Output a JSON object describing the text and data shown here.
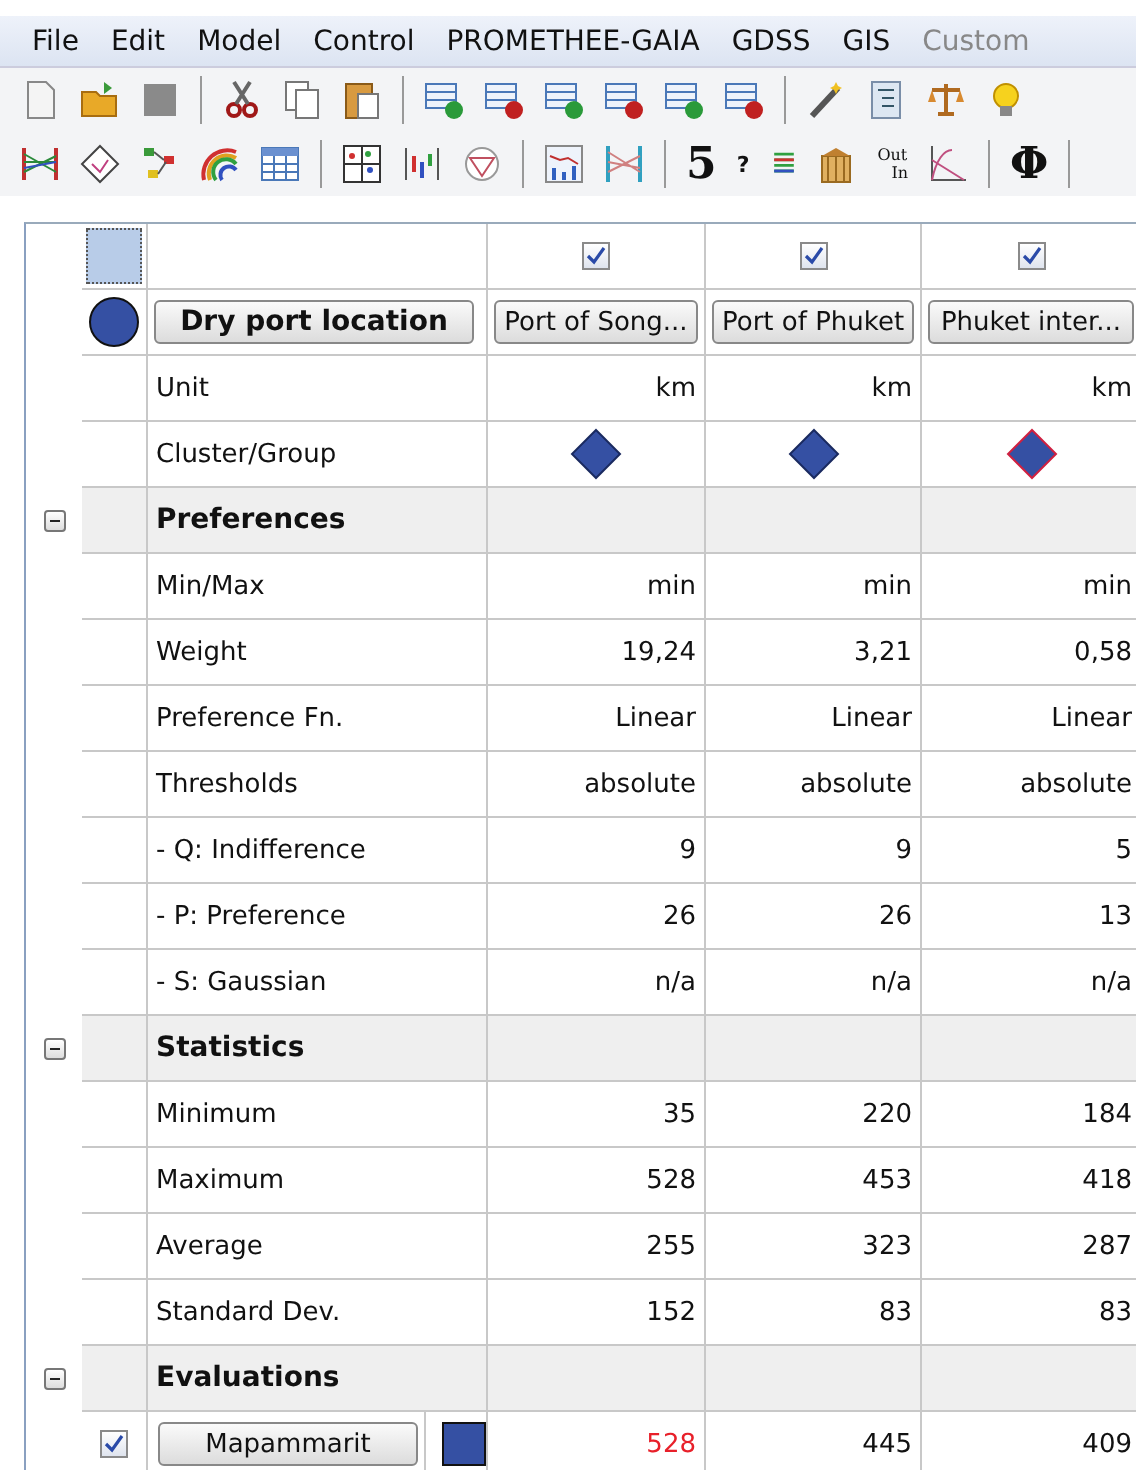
{
  "menu": [
    {
      "label": "File",
      "disabled": false
    },
    {
      "label": "Edit",
      "disabled": false
    },
    {
      "label": "Model",
      "disabled": false
    },
    {
      "label": "Control",
      "disabled": false
    },
    {
      "label": "PROMETHEE-GAIA",
      "disabled": false
    },
    {
      "label": "GDSS",
      "disabled": false
    },
    {
      "label": "GIS",
      "disabled": false
    },
    {
      "label": "Custom",
      "disabled": true
    }
  ],
  "toolbar": {
    "number_glyph": "5",
    "help_glyph": "?",
    "out_label": "Out",
    "in_label": "In",
    "phi_glyph": "Φ"
  },
  "table": {
    "corner_selected": true,
    "scenario": {
      "color": "#3550a3",
      "name": "Dry port location"
    },
    "criteria": [
      {
        "checked": true,
        "name": "Port of Song...",
        "color": "#3550a3",
        "cluster_marked": false
      },
      {
        "checked": true,
        "name": "Port of Phuket",
        "color": "#3550a3",
        "cluster_marked": false
      },
      {
        "checked": true,
        "name": "Phuket inter...",
        "color": "#3550a3",
        "cluster_marked": true
      }
    ],
    "rows": [
      {
        "kind": "data",
        "label": "Unit",
        "values": [
          "km",
          "km",
          "km"
        ]
      },
      {
        "kind": "cluster",
        "label": "Cluster/Group"
      },
      {
        "kind": "section",
        "label": "Preferences",
        "expanded": true
      },
      {
        "kind": "data",
        "label": "Min/Max",
        "values": [
          "min",
          "min",
          "min"
        ]
      },
      {
        "kind": "data",
        "label": "Weight",
        "values": [
          "19,24",
          "3,21",
          "0,58"
        ]
      },
      {
        "kind": "data",
        "label": "Preference Fn.",
        "values": [
          "Linear",
          "Linear",
          "Linear"
        ]
      },
      {
        "kind": "data",
        "label": "Thresholds",
        "values": [
          "absolute",
          "absolute",
          "absolute"
        ]
      },
      {
        "kind": "data",
        "label": "- Q: Indifference",
        "values": [
          "9",
          "9",
          "5"
        ]
      },
      {
        "kind": "data",
        "label": "- P: Preference",
        "values": [
          "26",
          "26",
          "13"
        ]
      },
      {
        "kind": "data",
        "label": "- S: Gaussian",
        "values": [
          "n/a",
          "n/a",
          "n/a"
        ]
      },
      {
        "kind": "section",
        "label": "Statistics",
        "expanded": true
      },
      {
        "kind": "data",
        "label": "Minimum",
        "values": [
          "35",
          "220",
          "184"
        ]
      },
      {
        "kind": "data",
        "label": "Maximum",
        "values": [
          "528",
          "453",
          "418"
        ]
      },
      {
        "kind": "data",
        "label": "Average",
        "values": [
          "255",
          "323",
          "287"
        ]
      },
      {
        "kind": "data",
        "label": "Standard Dev.",
        "values": [
          "152",
          "83",
          "83"
        ]
      },
      {
        "kind": "section",
        "label": "Evaluations",
        "expanded": true
      },
      {
        "kind": "action",
        "checked": true,
        "label": "Mapammarit",
        "color": "#3550a3",
        "values": [
          {
            "text": "528",
            "highlighted": true
          },
          {
            "text": "445",
            "highlighted": false
          },
          {
            "text": "409",
            "highlighted": false
          }
        ]
      }
    ]
  }
}
